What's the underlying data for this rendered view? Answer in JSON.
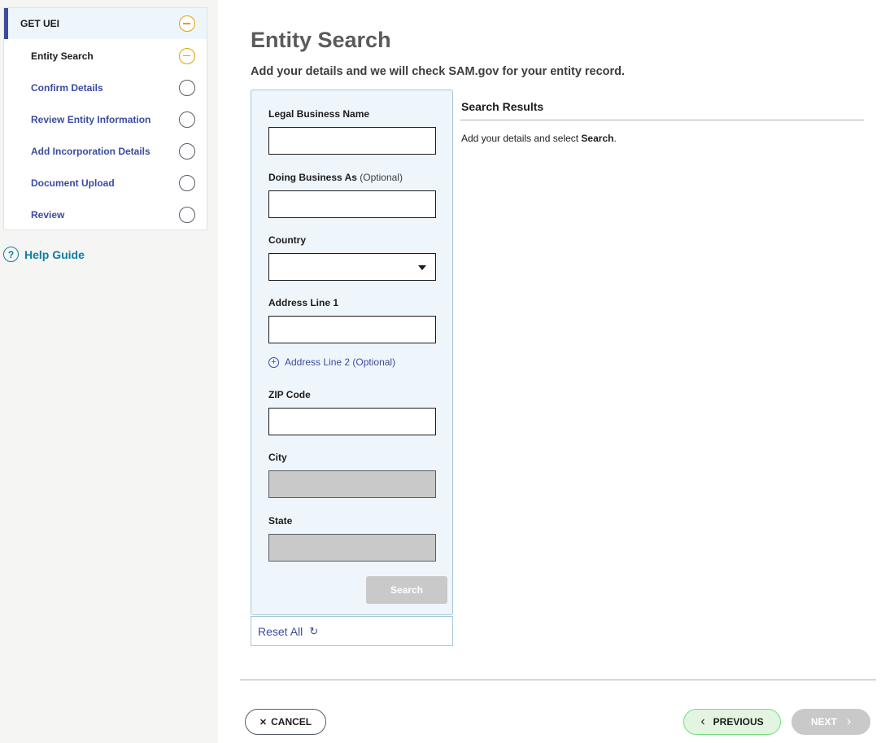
{
  "sidebar": {
    "header": "GET UEI",
    "steps": [
      {
        "label": "Entity Search",
        "state": "current"
      },
      {
        "label": "Confirm Details",
        "state": "incomplete"
      },
      {
        "label": "Review Entity Information",
        "state": "incomplete"
      },
      {
        "label": "Add Incorporation Details",
        "state": "incomplete"
      },
      {
        "label": "Document Upload",
        "state": "incomplete"
      },
      {
        "label": "Review",
        "state": "incomplete"
      }
    ],
    "help": {
      "icon": "?",
      "label": "Help Guide"
    }
  },
  "page": {
    "title": "Entity Search",
    "subtitle": "Add your details and we will check SAM.gov for your entity record."
  },
  "form": {
    "legal_name_label": "Legal Business Name",
    "dba_label": "Doing Business As",
    "dba_optional": "(Optional)",
    "country_label": "Country",
    "country_value": "",
    "address1_label": "Address Line 1",
    "address2_link": "Address Line 2 (Optional)",
    "zip_label": "ZIP Code",
    "city_label": "City",
    "state_label": "State",
    "search_button": "Search",
    "reset_label": "Reset All"
  },
  "results": {
    "title": "Search Results",
    "hint_prefix": "Add your details and select ",
    "hint_bold": "Search",
    "hint_suffix": "."
  },
  "footer": {
    "cancel": "CANCEL",
    "previous": "PREVIOUS",
    "next": "NEXT"
  },
  "colors": {
    "primary": "#3a4ba0",
    "active_step": "#e5a000",
    "help": "#0d7ea2",
    "panel_bg": "#eff6fb",
    "disabled": "#c9c9c9",
    "previous_bg": "#e3f5e1"
  }
}
